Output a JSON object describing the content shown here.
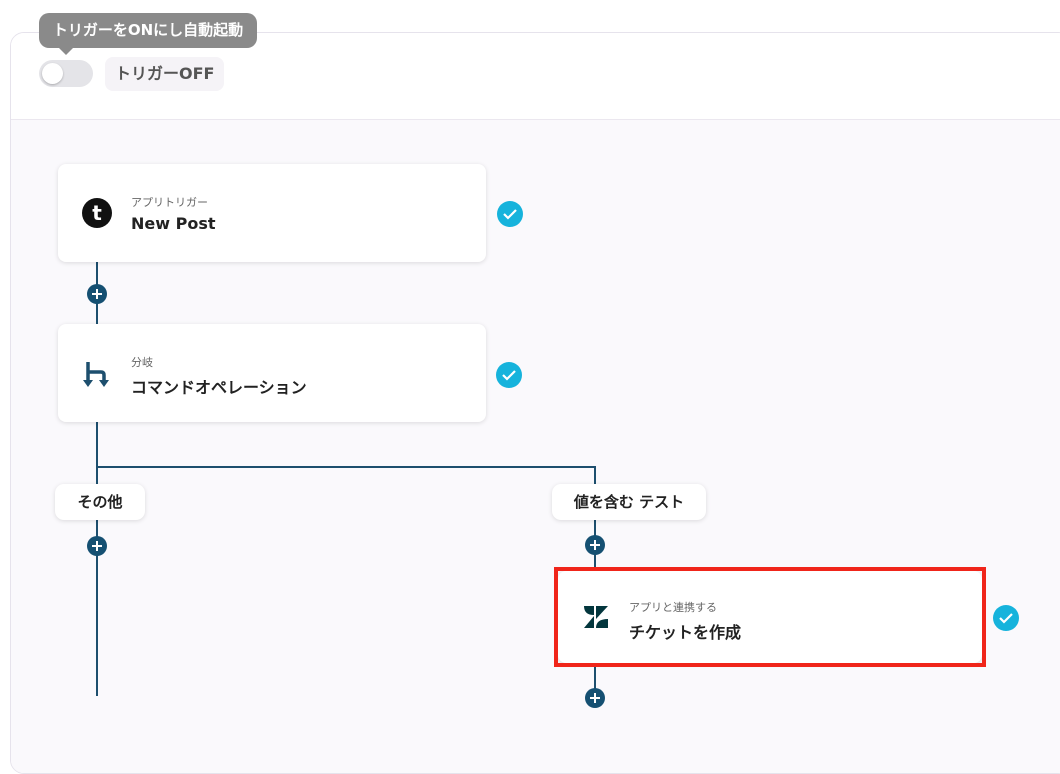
{
  "header": {
    "tooltip": "トリガーをONにし自動起動",
    "trigger_state": "トリガーOFF",
    "trigger_on": false
  },
  "flow": {
    "steps": [
      {
        "sub": "アプリトリガー",
        "title": "New Post",
        "icon": "tumblr-icon",
        "status": "done"
      },
      {
        "sub": "分岐",
        "title": "コマンドオペレーション",
        "icon": "branch-icon",
        "status": "done"
      },
      {
        "sub": "アプリと連携する",
        "title": "チケットを作成",
        "icon": "zendesk-icon",
        "status": "done"
      }
    ],
    "branches": [
      {
        "label": "その他"
      },
      {
        "label": "値を含む テスト"
      }
    ]
  },
  "colors": {
    "connector": "#1d4f6e",
    "check": "#16b3dc",
    "highlight": "#f0251a"
  }
}
